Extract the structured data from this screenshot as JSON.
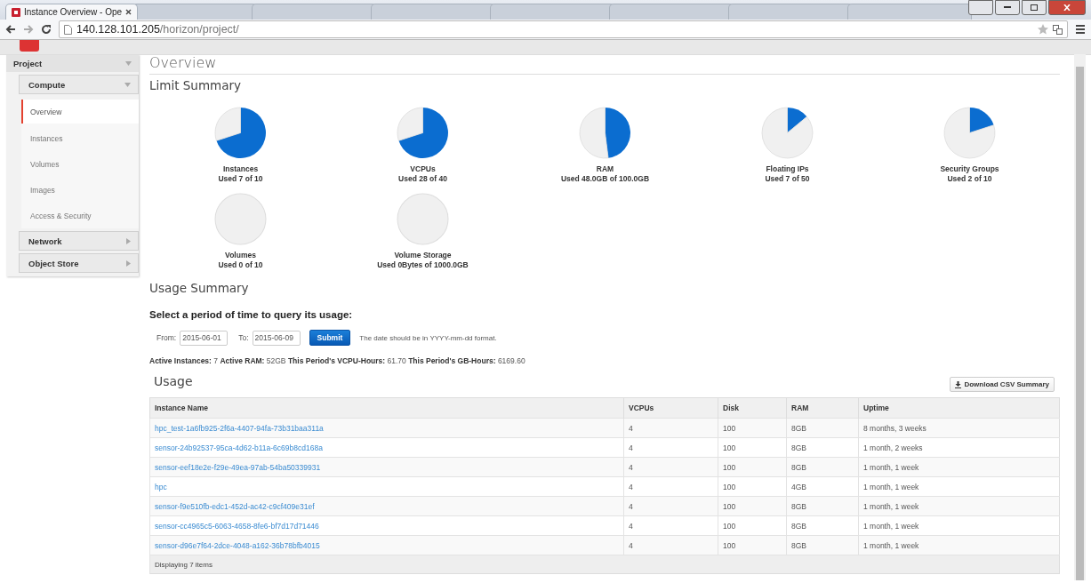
{
  "browser": {
    "tabs": [
      {
        "title": "Instance Overview - Ope",
        "selected": true
      },
      {
        "selected": false
      },
      {
        "selected": false
      },
      {
        "selected": false
      },
      {
        "selected": false
      },
      {
        "selected": false
      },
      {
        "selected": false
      },
      {
        "selected": false
      }
    ],
    "address": {
      "host": "140.128.101.205",
      "path": "/horizon/project/"
    }
  },
  "sidebar": {
    "items": [
      {
        "label": "Project",
        "kind": "dashboard",
        "expanded": true,
        "children": [
          {
            "label": "Compute",
            "kind": "panel",
            "expanded": true,
            "children": [
              {
                "label": "Overview",
                "kind": "link",
                "selected": true
              },
              {
                "label": "Instances",
                "kind": "link",
                "selected": false
              },
              {
                "label": "Volumes",
                "kind": "link",
                "selected": false
              },
              {
                "label": "Images",
                "kind": "link",
                "selected": false
              },
              {
                "label": "Access & Security",
                "kind": "link",
                "selected": false
              }
            ]
          },
          {
            "label": "Network",
            "kind": "panel",
            "expanded": false
          },
          {
            "label": "Object Store",
            "kind": "panel",
            "expanded": false
          }
        ]
      }
    ]
  },
  "page_title": "Overview",
  "limit_summary": {
    "title": "Limit Summary",
    "limits": [
      {
        "name": "Instances",
        "usage": "Used 7 of 10",
        "chart_data": {
          "type": "pie",
          "values": [
            70,
            30
          ]
        }
      },
      {
        "name": "VCPUs",
        "usage": "Used 28 of 40",
        "chart_data": {
          "type": "pie",
          "values": [
            70,
            30
          ]
        }
      },
      {
        "name": "RAM",
        "usage": "Used 48.0GB of 100.0GB",
        "chart_data": {
          "type": "pie",
          "values": [
            48,
            52
          ]
        }
      },
      {
        "name": "Floating IPs",
        "usage": "Used 7 of 50",
        "chart_data": {
          "type": "pie",
          "values": [
            14,
            86
          ]
        }
      },
      {
        "name": "Security Groups",
        "usage": "Used 2 of 10",
        "chart_data": {
          "type": "pie",
          "values": [
            20,
            80
          ]
        }
      },
      {
        "name": "Volumes",
        "usage": "Used 0 of 10",
        "chart_data": {
          "type": "pie",
          "values": [
            0,
            100
          ]
        }
      },
      {
        "name": "Volume Storage",
        "usage": "Used 0Bytes of 1000.0GB",
        "chart_data": {
          "type": "pie",
          "values": [
            0,
            100
          ]
        }
      }
    ]
  },
  "usage_summary": {
    "title": "Usage Summary",
    "subtitle": "Select a period of time to query its usage:",
    "from": {
      "label": "From:",
      "value": "2015-06-01"
    },
    "to": {
      "label": "To:",
      "value": "2015-06-09"
    },
    "submit": "Submit",
    "hint": "The date should be in YYYY-mm-dd format.",
    "stats": "**Active Instances:** 7 **Active RAM:** 52GB **This Period's VCPU-Hours:** 61.70 **This Period's GB-Hours:** 6169.60"
  },
  "usage": {
    "title": "Usage",
    "download_button": "Download CSV Summary",
    "table": {
      "columns": [
        "Instance Name",
        "VCPUs",
        "Disk",
        "RAM",
        "Uptime"
      ],
      "rows": [
        [
          "hpc_test-1a6fb925-2f6a-4407-94fa-73b31baa311a",
          "4",
          "100",
          "8GB",
          "8 months, 3 weeks"
        ],
        [
          "sensor-24b92537-95ca-4d62-b11a-6c69b8cd168a",
          "4",
          "100",
          "8GB",
          "1 month, 2 weeks"
        ],
        [
          "sensor-eef18e2e-f29e-49ea-97ab-54ba50339931",
          "4",
          "100",
          "8GB",
          "1 month, 1 week"
        ],
        [
          "hpc",
          "4",
          "100",
          "4GB",
          "1 month, 1 week"
        ],
        [
          "sensor-f9e510fb-edc1-452d-ac42-c9cf409e31ef",
          "4",
          "100",
          "8GB",
          "1 month, 1 week"
        ],
        [
          "sensor-cc4965c5-6063-4658-8fe6-bf7d17d71446",
          "4",
          "100",
          "8GB",
          "1 month, 1 week"
        ],
        [
          "sensor-d96e7f64-2dce-4048-a162-36b78bfb4015",
          "4",
          "100",
          "8GB",
          "1 month, 1 week"
        ]
      ],
      "footer": "Displaying 7 items"
    }
  }
}
